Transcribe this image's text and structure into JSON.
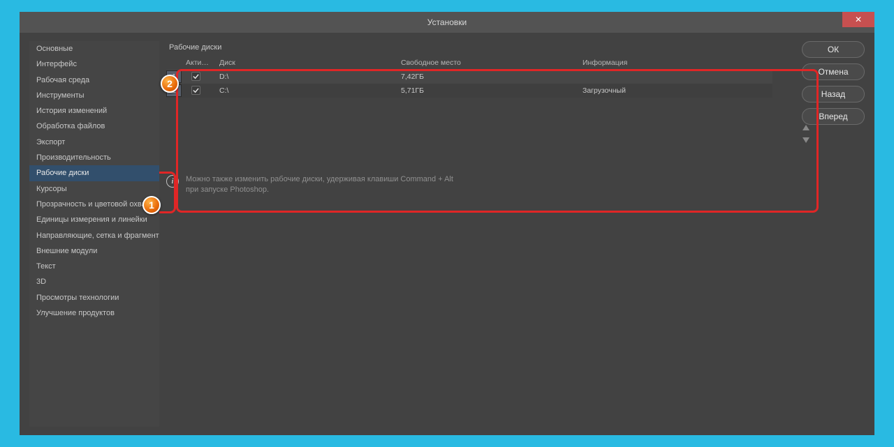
{
  "window": {
    "title": "Установки",
    "close": "✕"
  },
  "sidebar": {
    "items": [
      "Основные",
      "Интерфейс",
      "Рабочая среда",
      "Инструменты",
      "История изменений",
      "Обработка файлов",
      "Экспорт",
      "Производительность",
      "Рабочие диски",
      "Курсоры",
      "Прозрачность и цветовой охват",
      "Единицы измерения и линейки",
      "Направляющие, сетка и фрагменты",
      "Внешние модули",
      "Текст",
      "3D",
      "Просмотры технологии",
      "Улучшение продуктов"
    ],
    "selected_index": 8
  },
  "panel": {
    "label": "Рабочие диски",
    "columns": {
      "active": "Актив...",
      "drive": "Диск",
      "free": "Свободное место",
      "info": "Информация"
    },
    "rows": [
      {
        "idx": "1",
        "active": true,
        "drive": "D:\\",
        "free": "7,42ГБ",
        "info": ""
      },
      {
        "idx": "2",
        "active": true,
        "drive": "C:\\",
        "free": "5,71ГБ",
        "info": "Загрузочный"
      }
    ]
  },
  "hint": {
    "line1": "Можно также изменить рабочие диски, удерживая клавиши Command + Alt",
    "line2": "при запуске Photoshop."
  },
  "buttons": {
    "ok": "ОК",
    "cancel": "Отмена",
    "back": "Назад",
    "forward": "Вперед"
  },
  "annotations": {
    "badge1": "1",
    "badge2": "2"
  }
}
